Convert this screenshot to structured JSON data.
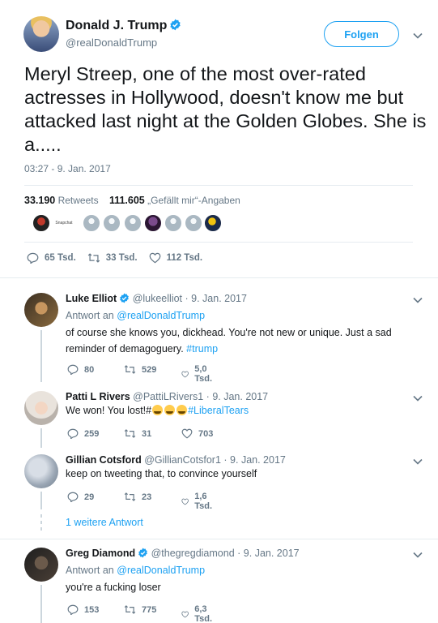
{
  "main_tweet": {
    "display_name": "Donald J. Trump",
    "handle": "@realDonaldTrump",
    "follow_label": "Folgen",
    "text": "Meryl Streep, one of the most over-rated actresses in Hollywood, doesn't know me but attacked last night at the Golden Globes. She is a.....",
    "timestamp": "03:27 - 9. Jan. 2017",
    "retweet_count": "33.190",
    "retweet_label": "Retweets",
    "like_count": "111.605",
    "like_label": "„Gefällt mir“-Angaben",
    "likers_badge": "Snapchat",
    "replies": "65 Tsd.",
    "retweets_short": "33 Tsd.",
    "likes_short": "112 Tsd."
  },
  "replies": [
    {
      "display_name": "Luke Elliot",
      "verified": true,
      "handle": "@lukeelliot",
      "date": "9. Jan. 2017",
      "reply_prefix": "Antwort an",
      "reply_to": "@realDonaldTrump",
      "text_main": "of course she knows you, dickhead.  You're not new or unique.  Just a sad reminder of demagoguery. ",
      "hashtag": "#trump",
      "replies": "80",
      "retweets": "529",
      "likes": "5,0 Tsd."
    },
    {
      "display_name": "Patti L Rivers",
      "handle": "@PattiLRivers1",
      "date": "9. Jan. 2017",
      "text_main": "We won! You lost!#",
      "hashtag": "#LiberalTears",
      "replies": "259",
      "retweets": "31",
      "likes": "703"
    },
    {
      "display_name": "Gillian Cotsford",
      "handle": "@GillianCotsfor1",
      "date": "9. Jan. 2017",
      "text_main": "keep on tweeting that, to convince yourself",
      "replies": "29",
      "retweets": "23",
      "likes": "1,6 Tsd.",
      "more_replies": "1 weitere Antwort"
    },
    {
      "display_name": "Greg Diamond",
      "verified": true,
      "handle": "@thegregdiamond",
      "date": "9. Jan. 2017",
      "reply_prefix": "Antwort an",
      "reply_to": "@realDonaldTrump",
      "text_main": "you're a fucking loser",
      "replies": "153",
      "retweets": "775",
      "likes": "6,3 Tsd."
    }
  ],
  "colors": {
    "accent": "#1da1f2",
    "text": "#14171a",
    "muted": "#657786",
    "divider": "#e6ecf0"
  },
  "icons": [
    "verified-badge-icon",
    "chevron-down-icon",
    "reply-icon",
    "retweet-icon",
    "heart-icon"
  ]
}
